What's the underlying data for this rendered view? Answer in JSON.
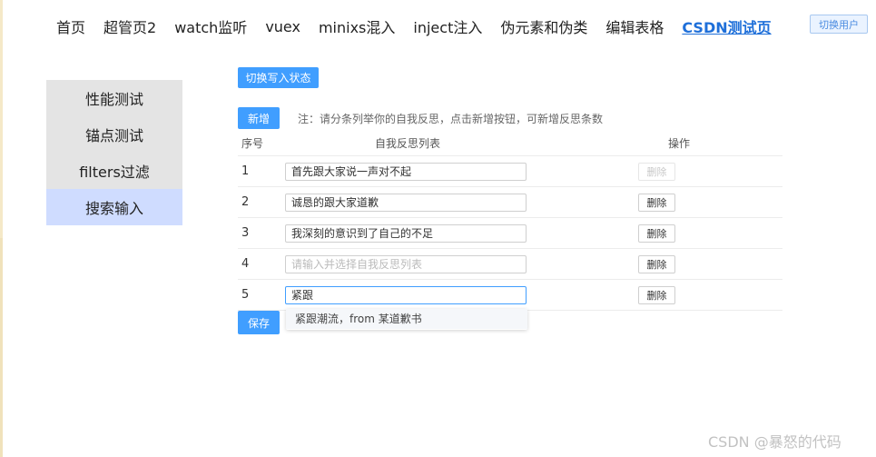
{
  "nav": {
    "items": [
      "首页",
      "超管页2",
      "watch监听",
      "vuex",
      "minixs混入",
      "inject注入",
      "伪元素和伪类",
      "编辑表格",
      "CSDN测试页"
    ],
    "active_index": 8,
    "switch_user_label": "切换用户"
  },
  "sidemenu": {
    "items": [
      "性能测试",
      "锚点测试",
      "filters过滤",
      "搜索输入"
    ],
    "active_index": 3
  },
  "toolbar": {
    "toggle_label": "切换写入状态",
    "add_label": "新增",
    "note": "注：请分条列举你的自我反思，点击新增按钮，可新增反思条数",
    "save_label": "保存"
  },
  "table": {
    "headers": {
      "index": "序号",
      "list": "自我反思列表",
      "ops": "操作"
    },
    "placeholder": "请输入并选择自我反思列表",
    "delete_label": "删除",
    "rows": [
      {
        "index": "1",
        "value": "首先跟大家说一声对不起",
        "delete_disabled": true
      },
      {
        "index": "2",
        "value": "诚恳的跟大家道歉",
        "delete_disabled": false
      },
      {
        "index": "3",
        "value": "我深刻的意识到了自己的不足",
        "delete_disabled": false
      },
      {
        "index": "4",
        "value": "",
        "delete_disabled": false
      },
      {
        "index": "5",
        "value": "紧跟",
        "delete_disabled": false,
        "focused": true
      }
    ]
  },
  "autocomplete": {
    "items": [
      "紧跟潮流，from 某道歉书"
    ]
  },
  "watermark": "CSDN @暴怒的代码"
}
